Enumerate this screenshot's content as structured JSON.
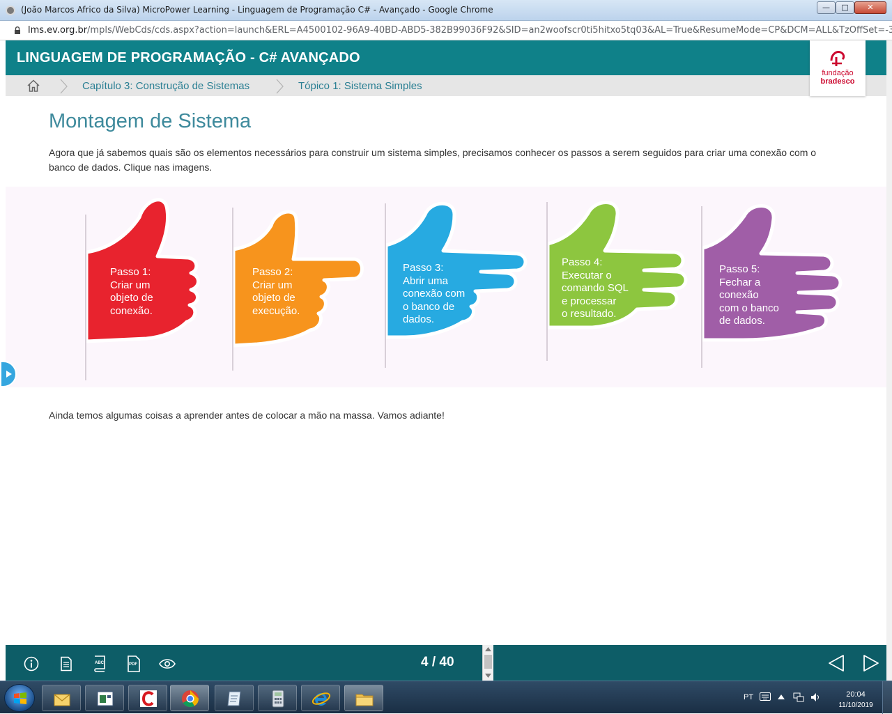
{
  "browser": {
    "window_title": "(João Marcos Africo da Silva) MicroPower Learning - Linguagem de Programação C# - Avançado - Google Chrome",
    "url_host": "lms.ev.org.br",
    "url_path": "/mpls/WebCds/cds.aspx?action=launch&ERL=A4500102-96A9-40BD-ABD5-382B99036F92&SID=an2woofscr0ti5hitxo5tq03&AL=True&ResumeMode=CP&DCM=ALL&TzOffSet=-3&..."
  },
  "header": {
    "title": "LINGUAGEM DE PROGRAMAÇÃO - C# AVANÇADO",
    "logo_line1": "fundação",
    "logo_line2": "bradesco"
  },
  "breadcrumb": {
    "home_icon": "home-icon",
    "items": [
      "Capítulo 3: Construção de Sistemas",
      "Tópico 1: Sistema Simples"
    ]
  },
  "content": {
    "title": "Montagem de Sistema",
    "intro": "Agora que já sabemos quais são os elementos necessários para construir um sistema simples, precisamos conhecer os passos a serem seguidos para criar uma conexão com o banco de dados. Clique nas imagens.",
    "outro": "Ainda temos algumas coisas a aprender antes de colocar a mão na massa. Vamos adiante!"
  },
  "steps": [
    {
      "label": "Passo 1:\nCriar um\nobjeto de\nconexão.",
      "color": "#e8232e"
    },
    {
      "label": "Passo 2:\nCriar um\nobjeto de\nexecução.",
      "color": "#f7941d"
    },
    {
      "label": "Passo 3:\nAbrir uma\nconexão com\no banco de\ndados.",
      "color": "#27aae1"
    },
    {
      "label": "Passo 4:\nExecutar o\ncomando SQL\ne processar\no resultado.",
      "color": "#8dc63f"
    },
    {
      "label": "Passo 5:\nFechar a\nconexão\ncom o banco\nde dados.",
      "color": "#a05ea7"
    }
  ],
  "footer": {
    "page_counter": "4 / 40",
    "icons": [
      "info-icon",
      "document-icon",
      "glossary-icon",
      "pdf-icon",
      "view-icon"
    ],
    "pdf_glyph": "PDF",
    "abc_glyph": "ABC",
    "nav": [
      "previous-arrow-icon",
      "next-arrow-icon"
    ]
  },
  "taskbar": {
    "language": "PT",
    "time": "20:04",
    "date": "11/10/2019"
  },
  "colors": {
    "header_teal": "#0f8189",
    "footer_teal": "#0d5d67",
    "title_teal": "#3e8a9c",
    "breadcrumb_text": "#2a7f93",
    "brand_red": "#cc092f"
  }
}
